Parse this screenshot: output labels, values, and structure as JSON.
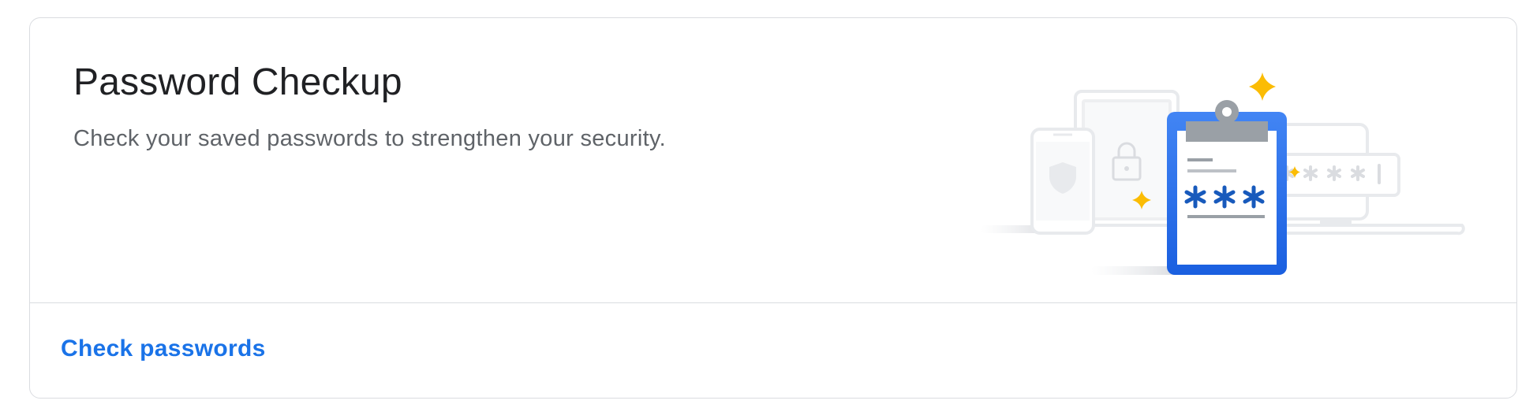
{
  "card": {
    "title": "Password Checkup",
    "subtitle": "Check your saved passwords to strengthen your security.",
    "illustration_icon": "password-checkup-clipboard-illustration",
    "action_label": "Check passwords"
  },
  "colors": {
    "link": "#1a73e8",
    "clipboard_blue": "#1a73e8",
    "sparkle": "#fbbc04",
    "asterisk": "#185abc",
    "device_outline": "#e8eaed"
  }
}
